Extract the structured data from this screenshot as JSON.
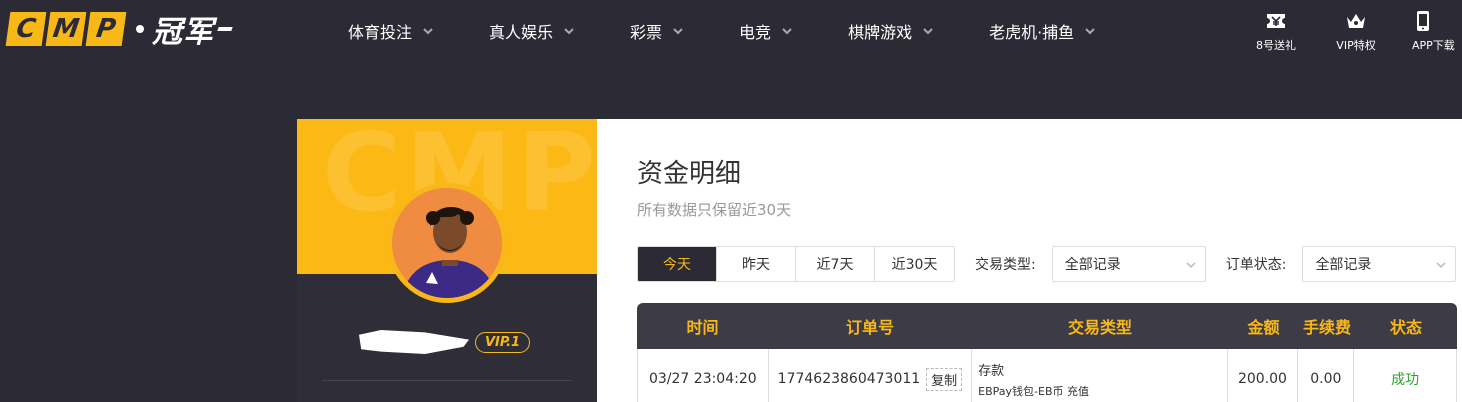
{
  "header": {
    "logo_letters": [
      "C",
      "M",
      "P"
    ],
    "logo_cn": "冠军",
    "nav": [
      {
        "label": "体育投注"
      },
      {
        "label": "真人娱乐"
      },
      {
        "label": "彩票"
      },
      {
        "label": "电竞"
      },
      {
        "label": "棋牌游戏"
      },
      {
        "label": "老虎机·捕鱼"
      }
    ],
    "right": [
      {
        "label": "8号送礼",
        "icon": "gift-ticket-icon"
      },
      {
        "label": "VIP特权",
        "icon": "crown-icon"
      },
      {
        "label": "APP下载",
        "icon": "phone-icon"
      }
    ]
  },
  "sidebar": {
    "bg_text": "CMP",
    "vip_label": "VIP.1"
  },
  "main": {
    "title": "资金明细",
    "subtitle": "所有数据只保留近30天",
    "date_tabs": [
      "今天",
      "昨天",
      "近7天",
      "近30天"
    ],
    "active_tab": 0,
    "type_label": "交易类型:",
    "type_value": "全部记录",
    "status_label": "订单状态:",
    "status_value": "全部记录"
  },
  "table": {
    "columns": [
      "时间",
      "订单号",
      "交易类型",
      "金额",
      "手续费",
      "状态"
    ],
    "rows": [
      {
        "time": "03/27 23:04:20",
        "order_no": "1774623860473011",
        "copy_label": "复制",
        "type": "存款",
        "type_detail": "EBPay钱包-EB币 充值",
        "amount": "200.00",
        "fee": "0.00",
        "status": "成功"
      }
    ]
  },
  "colors": {
    "accent": "#f8b817",
    "dark": "#2c2b35",
    "success": "#2ca52c"
  }
}
